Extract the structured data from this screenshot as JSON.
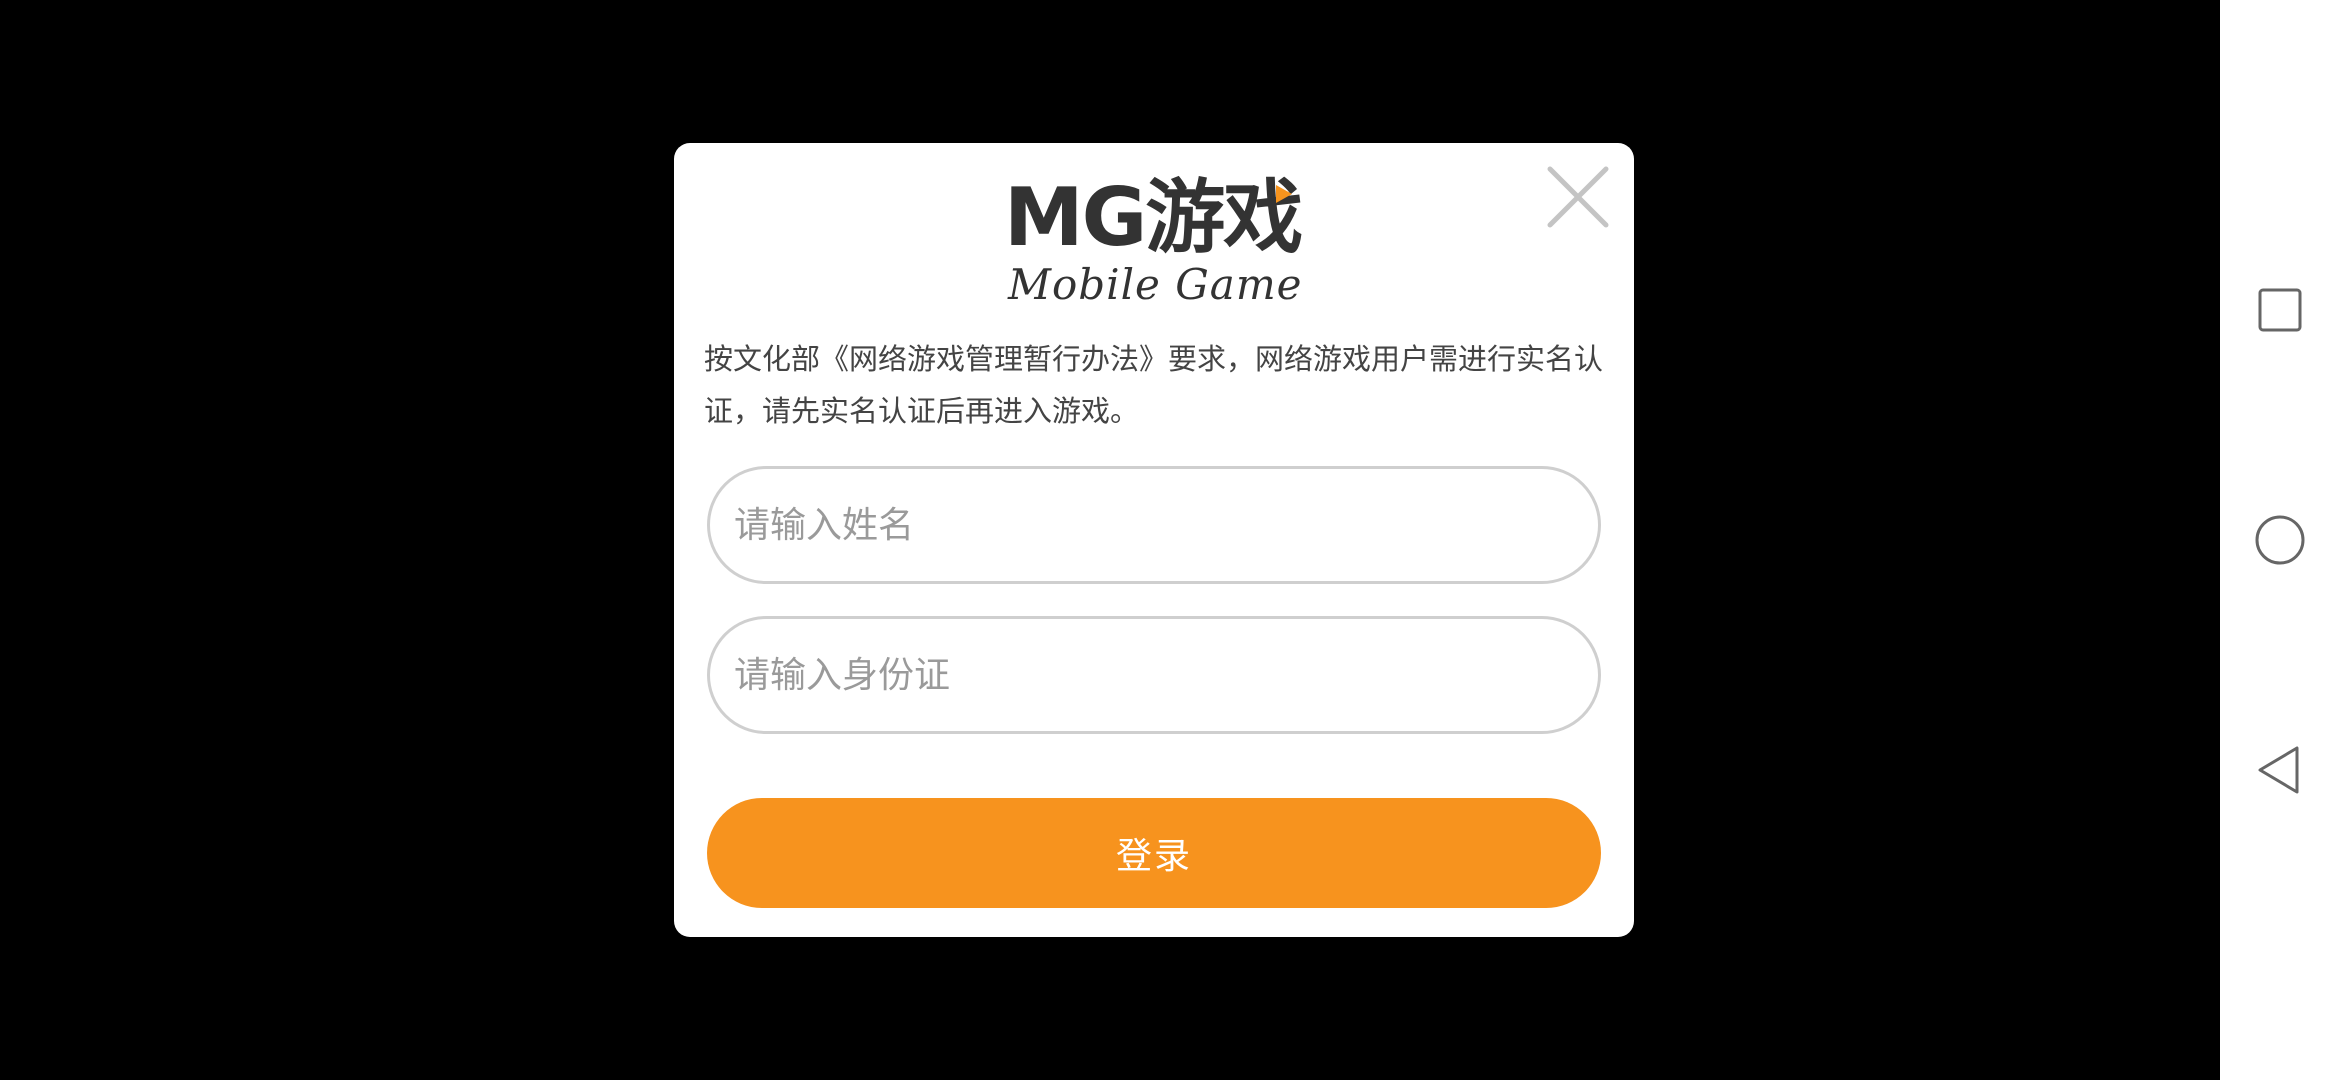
{
  "dialog": {
    "logo": {
      "main": "MG游戏",
      "sub": "Mobile Game"
    },
    "notice": "按文化部《网络游戏管理暂行办法》要求，网络游戏用户需进行实名认证，请先实名认证后再进入游戏。",
    "name_field": {
      "value": "",
      "placeholder": "请输入姓名"
    },
    "id_field": {
      "value": "",
      "placeholder": "请输入身份证"
    },
    "login_label": "登录",
    "close_icon": "close-icon"
  },
  "navbar": {
    "recent_icon": "square-icon",
    "home_icon": "circle-icon",
    "back_icon": "triangle-back-icon"
  },
  "colors": {
    "accent": "#f7931e",
    "border": "#cfcfcf",
    "text": "#444444",
    "placeholder": "#9a9a9a"
  }
}
